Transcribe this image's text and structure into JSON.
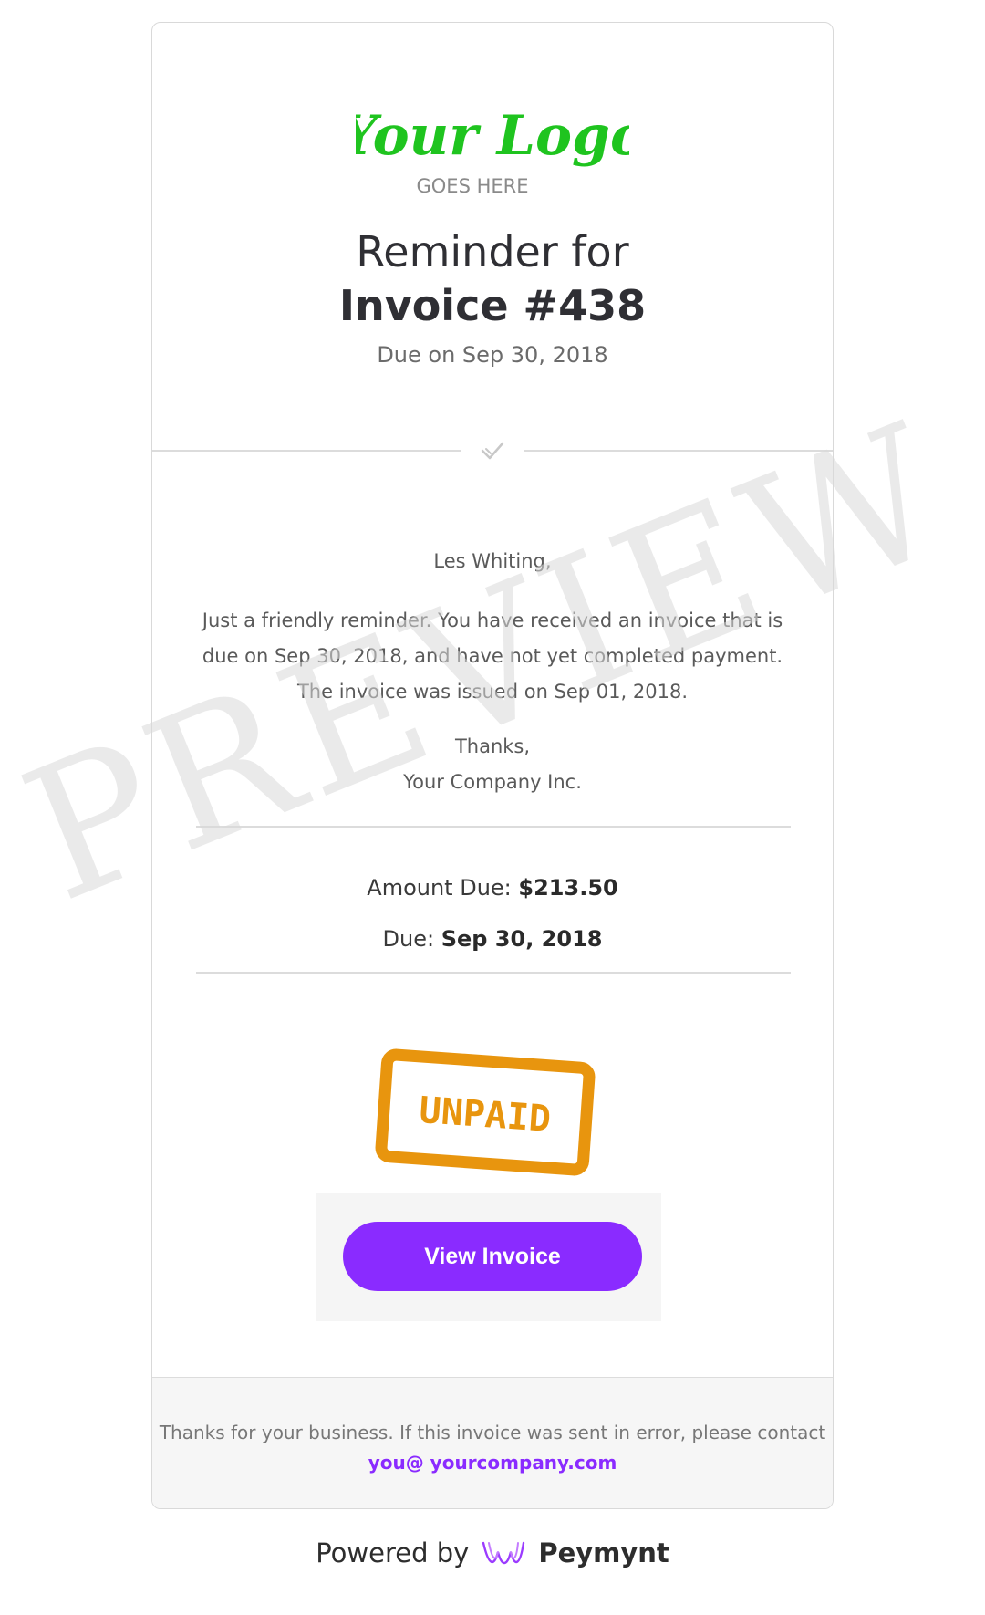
{
  "logo": {
    "main_text": "Your Logo",
    "sub_text": "GOES HERE",
    "color": "#1fc41f"
  },
  "header": {
    "title_line1": "Reminder for",
    "title_line2": "Invoice #438",
    "due_subtitle": "Due on Sep 30, 2018"
  },
  "message": {
    "greeting": "Les Whiting,",
    "body": "Just a friendly reminder. You have received an invoice that is due on Sep 30, 2018, and have not yet completed payment. The invoice was issued on Sep 01, 2018.",
    "thanks": "Thanks,",
    "company": "Your Company Inc."
  },
  "summary": {
    "amount_label": "Amount Due:",
    "amount_value": "$213.50",
    "due_label": "Due:",
    "due_value": "Sep 30, 2018"
  },
  "stamp": {
    "text": "UNPAID",
    "color": "#e8950e"
  },
  "button": {
    "label": "View Invoice",
    "color": "#8a2bff"
  },
  "footer": {
    "text": "Thanks for your business. If this invoice was sent in error, please contact",
    "email": "you@ yourcompany.com"
  },
  "powered": {
    "label": "Powered by",
    "brand": "Peymynt",
    "icon": "peymynt-logo-icon"
  },
  "watermark": {
    "text": "PREVIEW"
  }
}
